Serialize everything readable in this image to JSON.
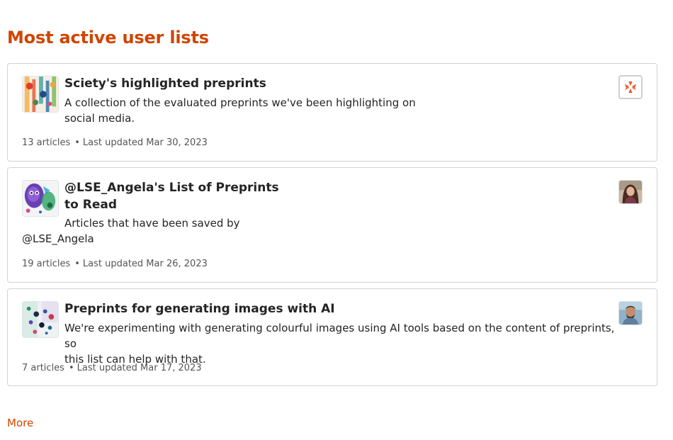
{
  "section": {
    "title": "Most active user lists"
  },
  "lists": [
    {
      "title": "Sciety's highlighted preprints",
      "description_lines": [
        "A collection of the evaluated preprints we've been highlighting on",
        "social media."
      ],
      "article_count": "13 articles",
      "separator": "•",
      "last_updated": "Last updated Mar 30, 2023",
      "thumbnail_icon": "abstract-art-thumbnail",
      "owner_avatar_icon": "sciety-logo-icon"
    },
    {
      "title_lines": [
        "@LSE_Angela's List of Preprints",
        "to Read"
      ],
      "description_lines": [
        "Articles that have been saved by",
        "@LSE_Angela"
      ],
      "article_count": "19 articles",
      "separator": "•",
      "last_updated": "Last updated Mar 26, 2023",
      "thumbnail_icon": "abstract-art-thumbnail",
      "owner_avatar_icon": "user-avatar"
    },
    {
      "title": "Preprints for generating images with AI",
      "description_lines": [
        "We're experimenting with generating colourful images using AI tools based on the content of preprints, so",
        "this list can help with that."
      ],
      "article_count": "7 articles",
      "separator": "•",
      "last_updated": "Last updated Mar 17, 2023",
      "thumbnail_icon": "abstract-art-thumbnail",
      "owner_avatar_icon": "user-avatar"
    }
  ],
  "more_link": "More",
  "colors": {
    "accent": "#cf4500",
    "border": "#d2d2d2",
    "text": "#242424",
    "muted": "#555555"
  }
}
